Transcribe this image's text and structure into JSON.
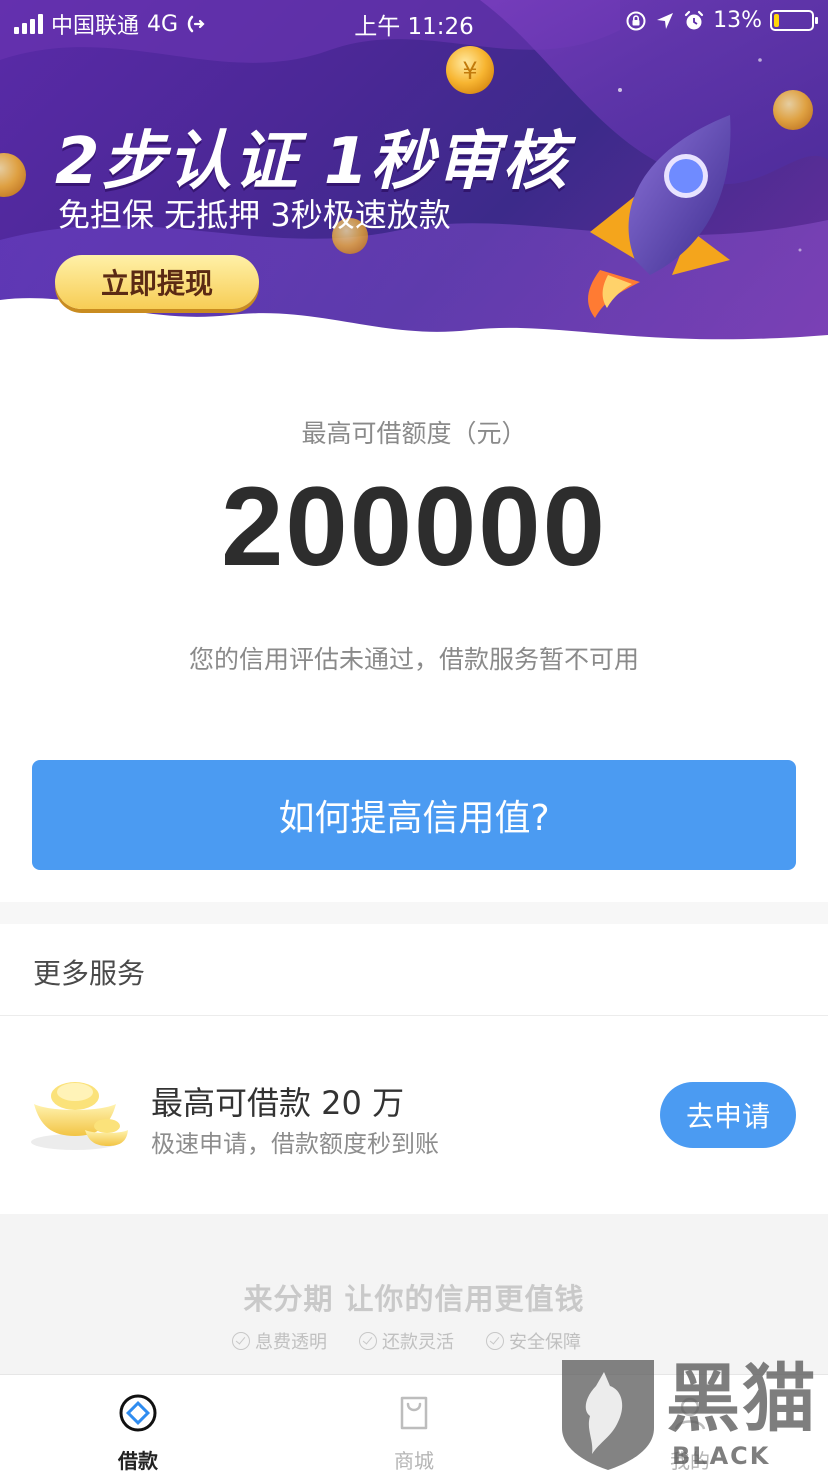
{
  "status_bar": {
    "carrier": "中国联通",
    "network": "4G",
    "time": "上午 11:26",
    "battery_percent": "13%",
    "battery_level": 0.13
  },
  "banner": {
    "title": "2步认证  1秒审核",
    "subtitle": "免担保 无抵押 3秒极速放款",
    "cta_label": "立即提现",
    "coin_symbol": "¥",
    "active_slide": 1,
    "slide_count": 2
  },
  "credit": {
    "label": "最高可借额度（元）",
    "amount": "200000",
    "note": "您的信用评估未通过，借款服务暂不可用",
    "action_label": "如何提高信用值?"
  },
  "more_services": {
    "title": "更多服务",
    "item": {
      "title": "最高可借款 20 万",
      "subtitle": "极速申请，借款额度秒到账",
      "button_label": "去申请"
    }
  },
  "footer": {
    "slogan": "来分期  让你的信用更值钱",
    "features": [
      "息费透明",
      "还款灵活",
      "安全保障"
    ]
  },
  "tabs": [
    {
      "label": "借款",
      "icon": "loan-icon",
      "active": true
    },
    {
      "label": "商城",
      "icon": "shop-bag-icon",
      "active": false
    },
    {
      "label": "我的",
      "icon": "profile-icon",
      "active": false
    }
  ],
  "watermark": {
    "text": "黑猫",
    "sub": "BLACK CAT"
  },
  "colors": {
    "primary": "#4b9bf2",
    "banner_purple": "#4b2896",
    "gold": "#f7cd55"
  }
}
